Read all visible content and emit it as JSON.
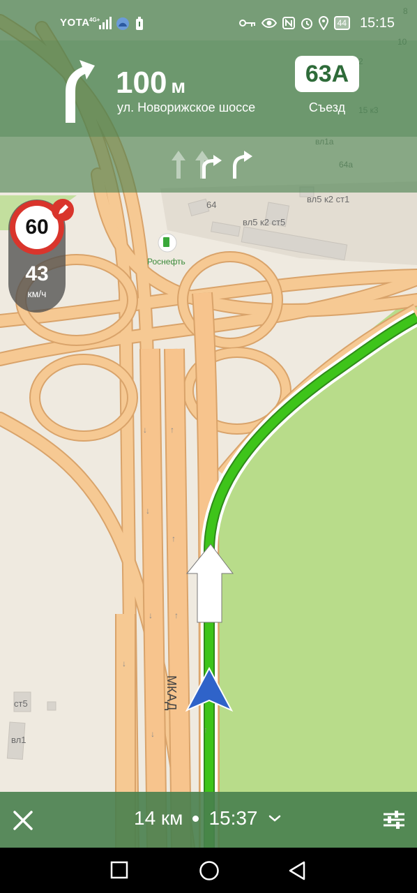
{
  "status_bar": {
    "carrier": "YOTA",
    "network": "4G+",
    "battery": "44",
    "time": "15:15",
    "icons": [
      "signal-icon",
      "cloud-icon",
      "battery-saver-icon",
      "key-icon",
      "eye-icon",
      "nfc-icon",
      "alarm-icon",
      "location-icon",
      "battery-icon"
    ]
  },
  "maneuver": {
    "distance_value": "100",
    "distance_unit": "м",
    "street": "ул. Новорижское шоссе",
    "exit_number": "63А",
    "exit_label": "Съезд"
  },
  "lanes": [
    "straight-lane-icon",
    "straight-lane-icon",
    "straight-right-lane-icon",
    "right-lane-icon"
  ],
  "speed": {
    "limit": "60",
    "current": "43",
    "unit": "км/ч"
  },
  "map": {
    "road_label": "МКАД",
    "poi": "Роснефть",
    "buildings": [
      "64",
      "вл5 к2 ст5",
      "вл5 к2 ст1",
      "64а",
      "вл1а",
      "15 к3",
      "10",
      "8",
      "2",
      "ст5",
      "вл1"
    ]
  },
  "trip": {
    "distance": "14 км",
    "arrival": "15:37"
  },
  "colors": {
    "banner": "#48804e",
    "route": "#3ec41a",
    "road": "#f6c993",
    "speed_limit": "#d9352c"
  }
}
